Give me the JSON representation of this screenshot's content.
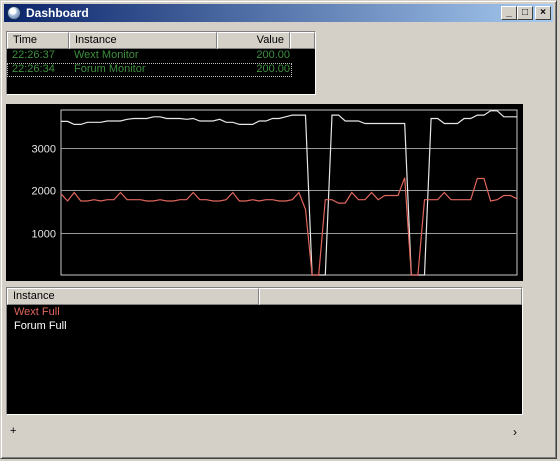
{
  "window": {
    "title": "Dashboard",
    "minimize_glyph": "_",
    "maximize_glyph": "□",
    "close_glyph": "×"
  },
  "top_list": {
    "columns": [
      "Time",
      "Instance",
      "Value"
    ],
    "rows": [
      {
        "time": "22:26:37",
        "instance": "Wext Monitor",
        "value": "200.00"
      },
      {
        "time": "22:26:34",
        "instance": "Forum Monitor",
        "value": "200.00"
      }
    ],
    "text_color": "#3e8e3e"
  },
  "chart_data": {
    "type": "line",
    "ylim": [
      0,
      3900
    ],
    "yticks": [
      1000,
      2000,
      3000
    ],
    "ytick_labels": [
      "1000",
      "2000",
      "3000"
    ],
    "grid": true,
    "x": [
      1,
      2,
      3,
      4,
      5,
      6,
      7,
      8,
      9,
      10,
      11,
      12,
      13,
      14,
      15,
      16,
      17,
      18,
      19,
      20,
      21,
      22,
      23,
      24,
      25,
      26,
      27,
      28,
      29,
      30,
      31,
      32,
      33,
      34,
      35,
      36,
      37,
      38,
      39,
      40,
      41,
      42,
      43,
      44,
      45,
      46,
      47,
      48,
      49,
      50,
      51,
      52,
      53,
      54,
      55,
      56,
      57,
      58,
      59,
      60,
      61,
      62,
      63,
      64,
      65,
      66,
      67,
      68,
      69,
      70
    ],
    "series": [
      {
        "name": "Forum Full",
        "color": "#e6e6e6",
        "values": [
          3630,
          3630,
          3560,
          3560,
          3610,
          3610,
          3610,
          3640,
          3640,
          3640,
          3680,
          3700,
          3700,
          3700,
          3740,
          3740,
          3700,
          3700,
          3700,
          3680,
          3700,
          3640,
          3640,
          3640,
          3680,
          3610,
          3610,
          3560,
          3560,
          3560,
          3640,
          3640,
          3700,
          3700,
          3740,
          3780,
          3780,
          3780,
          0,
          0,
          0,
          3780,
          3780,
          3640,
          3640,
          3640,
          3580,
          3580,
          3580,
          3580,
          3580,
          3580,
          3580,
          0,
          0,
          0,
          3700,
          3700,
          3580,
          3580,
          3580,
          3700,
          3700,
          3780,
          3780,
          3880,
          3880,
          3740,
          3740,
          3740
        ]
      },
      {
        "name": "Wext Full",
        "color": "#e0665c",
        "values": [
          1920,
          1750,
          1950,
          1750,
          1750,
          1780,
          1750,
          1780,
          1780,
          1950,
          1780,
          1780,
          1780,
          1750,
          1750,
          1780,
          1750,
          1750,
          1780,
          1780,
          1950,
          1780,
          1780,
          1750,
          1750,
          1780,
          1950,
          1750,
          1750,
          1780,
          1750,
          1780,
          1780,
          1750,
          1750,
          1780,
          1950,
          1550,
          0,
          0,
          1780,
          1780,
          1700,
          1700,
          1950,
          1780,
          1780,
          1950,
          1780,
          1880,
          1880,
          1880,
          2300,
          0,
          0,
          1780,
          1780,
          1780,
          1950,
          1780,
          1780,
          1780,
          1780,
          2280,
          2280,
          1750,
          1780,
          1880,
          1880,
          1800
        ]
      }
    ]
  },
  "legend_list": {
    "column": "Instance",
    "items": [
      {
        "label": "Wext Full",
        "color": "#e0665c"
      },
      {
        "label": "Forum Full",
        "color": "#ffffff"
      }
    ]
  },
  "status": {
    "left_glyph": "+",
    "right_glyph": "›"
  }
}
